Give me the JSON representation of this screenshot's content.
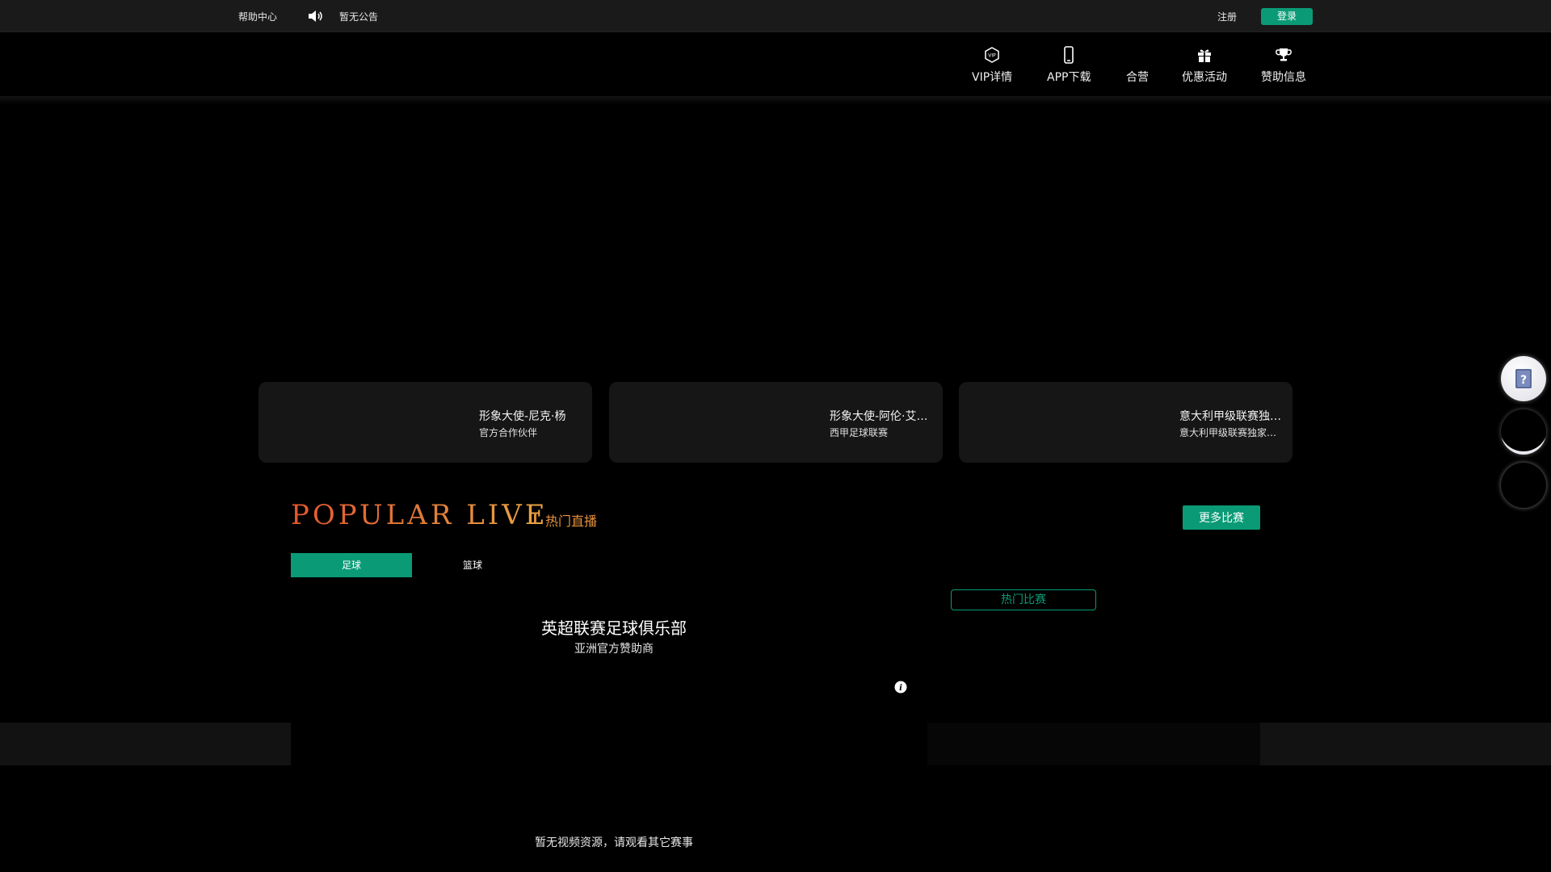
{
  "topbar": {
    "help_label": "帮助中心",
    "notice": "暂无公告",
    "register_label": "注册",
    "login_label": "登录"
  },
  "nav": {
    "items": [
      {
        "label": "VIP详情",
        "icon": "vip-icon"
      },
      {
        "label": "APP下载",
        "icon": "phone-icon"
      },
      {
        "label": "合营",
        "icon": ""
      },
      {
        "label": "优惠活动",
        "icon": "gift-icon"
      },
      {
        "label": "赞助信息",
        "icon": "trophy-icon"
      }
    ]
  },
  "promos": [
    {
      "title": "形象大使-尼克·杨",
      "subtitle": "官方合作伙伴"
    },
    {
      "title": "形象大使-阿伦·艾克森",
      "subtitle": "西甲足球联赛"
    },
    {
      "title": "意大利甲级联赛独家官方合作伙伴",
      "subtitle": "意大利甲级联赛独家官方合作伙伴"
    }
  ],
  "popular": {
    "title": "POPULAR LIVE",
    "subtitle": "热门直播",
    "more_label": "更多比赛",
    "tabs": [
      "足球",
      "篮球"
    ],
    "hot_match_label": "热门比赛",
    "sponsor_title": "英超联赛足球俱乐部",
    "sponsor_subtitle": "亚洲官方赞助商",
    "no_video": "暂无视频资源，请观看其它赛事"
  },
  "colors": {
    "accent": "#0a9b76",
    "popular_orange": "#e8913a",
    "topbar_bg": "#1a1a1a",
    "card_bg": "#161616"
  }
}
